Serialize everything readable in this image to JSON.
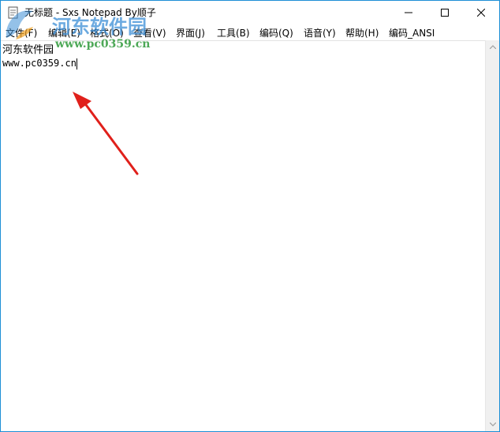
{
  "window": {
    "title": "无标题 - Sxs Notepad  By顺子",
    "controls": {
      "minimize_icon": "minimize-icon",
      "maximize_icon": "maximize-icon",
      "close_icon": "close-icon"
    }
  },
  "menubar": {
    "items": [
      {
        "label": "文件(F)"
      },
      {
        "label": "编辑(E)"
      },
      {
        "label": "格式(O)"
      },
      {
        "label": "查看(V)"
      },
      {
        "label": "界面(J)"
      },
      {
        "label": "工具(B)"
      },
      {
        "label": "编码(Q)"
      },
      {
        "label": "语音(Y)"
      },
      {
        "label": "帮助(H)"
      },
      {
        "label": "编码_ANSI"
      }
    ]
  },
  "editor": {
    "lines": [
      "河东软件园",
      "www.pc0359.cn"
    ]
  },
  "watermark": {
    "name": "河东软件园",
    "url": "www.pc0359.cn"
  },
  "colors": {
    "window_border": "#1e8fd6",
    "annotation_arrow": "#e0201b",
    "watermark_blue": "#3c8ed6",
    "watermark_green": "#2f9a3a"
  }
}
